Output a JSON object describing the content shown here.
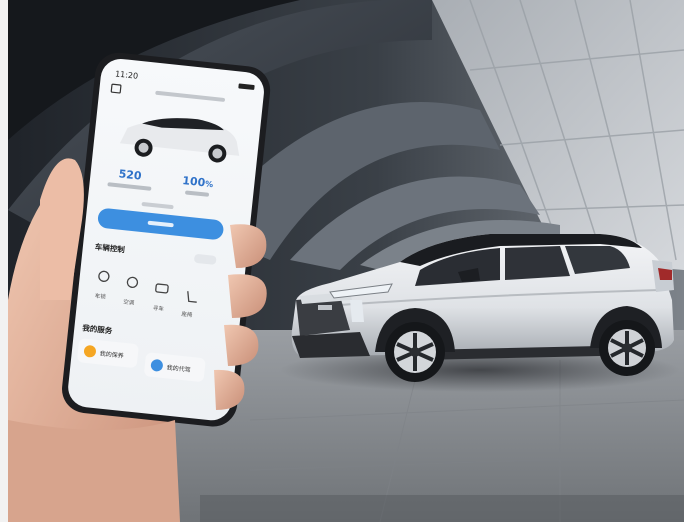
{
  "scene": {
    "background_colors": {
      "arch_dark": "#2b2f36",
      "arch_mid": "#5c636c",
      "wall_light": "#c8ccd1",
      "floor": "#8d9196",
      "car_body": "#e9ebee",
      "car_roof": "#1a1c20",
      "skin": "#e2b39c",
      "phone_frame": "#1c1d20"
    }
  },
  "phone": {
    "status_time": "11:20",
    "car_range_value": "520",
    "battery_value": "100",
    "battery_unit": "%",
    "primary_button_color": "#3d8fe0",
    "section_vehicle_control": "车辆控制",
    "controls": [
      {
        "label": "车锁",
        "icon": "lock-icon"
      },
      {
        "label": "空调",
        "icon": "fan-icon"
      },
      {
        "label": "寻车",
        "icon": "car-search-icon"
      },
      {
        "label": "座椅",
        "icon": "seat-icon"
      }
    ],
    "section_services": "我的服务",
    "services": [
      {
        "label": "我的保养",
        "icon": "maintenance-icon",
        "color": "#f5a623"
      },
      {
        "label": "我的代驾",
        "icon": "steering-icon",
        "color": "#3d8fe0"
      }
    ]
  }
}
